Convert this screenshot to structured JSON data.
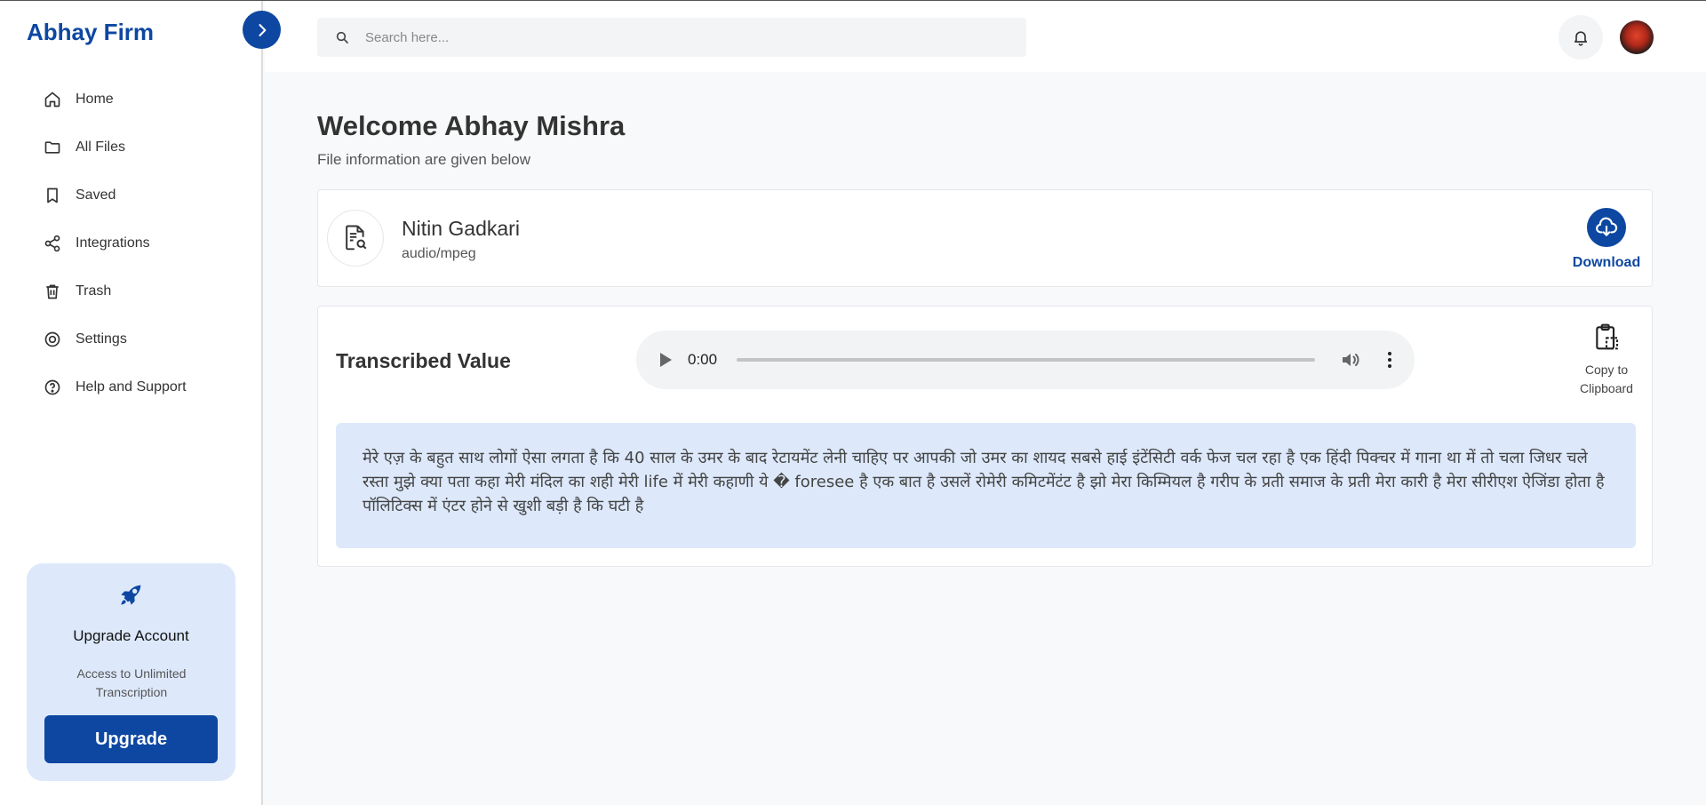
{
  "sidebar": {
    "brand": "Abhay Firm",
    "items": [
      {
        "label": "Home",
        "icon": "home-icon"
      },
      {
        "label": "All Files",
        "icon": "folder-icon"
      },
      {
        "label": "Saved",
        "icon": "bookmark-icon"
      },
      {
        "label": "Integrations",
        "icon": "share-icon"
      },
      {
        "label": "Trash",
        "icon": "trash-icon"
      },
      {
        "label": "Settings",
        "icon": "settings-icon"
      },
      {
        "label": "Help and Support",
        "icon": "help-icon"
      }
    ],
    "upgrade": {
      "title": "Upgrade Account",
      "description": "Access to Unlimited Transcription",
      "button": "Upgrade"
    }
  },
  "header": {
    "search_placeholder": "Search here..."
  },
  "main": {
    "welcome": "Welcome Abhay Mishra",
    "subtitle": "File information are given below",
    "file": {
      "name": "Nitin Gadkari",
      "type": "audio/mpeg",
      "download_label": "Download"
    },
    "transcription": {
      "title": "Transcribed Value",
      "audio_time": "0:00",
      "audio_progress": 0,
      "copy_label": "Copy to Clipboard",
      "text": "मेरे एज़ के बहुत साथ लोगों ऐसा लगता है कि 40 साल के उमर के बाद रेटायमेंट लेनी चाहिए पर आपकी जो उमर का शायद सबसे हाई इंटेंसिटी वर्क फेज चल रहा है एक हिंदी पिक्चर में गाना था में तो चला जिधर चले रस्ता मुझे क्या पता कहा मेरी मंदिल का शही मेरी life में मेरी कहाणी ये � foresee है एक बात है उसलें रोमेरी कमिटमेंटंट है झो मेरा किम्मियल है गरीप के प्रती समाज के प्रती मेरा कारी है मेरा सीरीएश ऐजिंडा होता है पॉलिटिक्स में एंटर होने से खुशी बड़ी है कि घटी है"
    }
  },
  "colors": {
    "brand": "#0d47a1",
    "card_bg": "#dde9fb",
    "page_bg": "#f8f9fa"
  }
}
